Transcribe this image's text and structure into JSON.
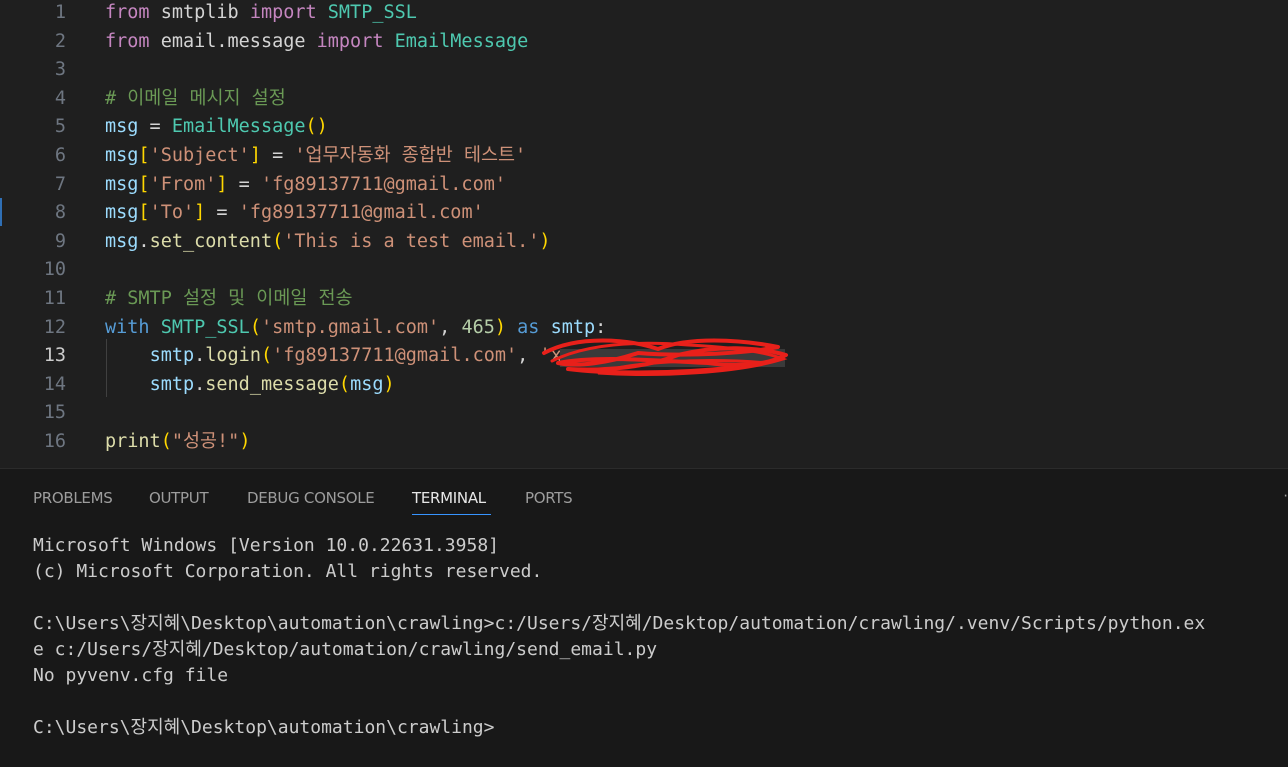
{
  "editor": {
    "active_line": "13",
    "lines": [
      {
        "n": "1",
        "tokens": [
          [
            "kw",
            "from"
          ],
          [
            "pl",
            " "
          ],
          [
            "pl",
            "smtplib"
          ],
          [
            "pl",
            " "
          ],
          [
            "kw",
            "import"
          ],
          [
            "pl",
            " "
          ],
          [
            "cls",
            "SMTP_SSL"
          ]
        ]
      },
      {
        "n": "2",
        "tokens": [
          [
            "kw",
            "from"
          ],
          [
            "pl",
            " "
          ],
          [
            "pl",
            "email.message"
          ],
          [
            "pl",
            " "
          ],
          [
            "kw",
            "import"
          ],
          [
            "pl",
            " "
          ],
          [
            "cls",
            "EmailMessage"
          ]
        ]
      },
      {
        "n": "3",
        "tokens": []
      },
      {
        "n": "4",
        "tokens": [
          [
            "cm",
            "# 이메일 메시지 설정"
          ]
        ]
      },
      {
        "n": "5",
        "tokens": [
          [
            "var",
            "msg"
          ],
          [
            "pl",
            " = "
          ],
          [
            "cls",
            "EmailMessage"
          ],
          [
            "b1",
            "()"
          ]
        ]
      },
      {
        "n": "6",
        "tokens": [
          [
            "var",
            "msg"
          ],
          [
            "b1",
            "["
          ],
          [
            "str",
            "'Subject'"
          ],
          [
            "b1",
            "]"
          ],
          [
            "pl",
            " = "
          ],
          [
            "str",
            "'업무자동화 종합반 테스트'"
          ]
        ]
      },
      {
        "n": "7",
        "tokens": [
          [
            "var",
            "msg"
          ],
          [
            "b1",
            "["
          ],
          [
            "str",
            "'From'"
          ],
          [
            "b1",
            "]"
          ],
          [
            "pl",
            " = "
          ],
          [
            "str",
            "'fg89137711@gmail.com'"
          ]
        ]
      },
      {
        "n": "8",
        "tokens": [
          [
            "var",
            "msg"
          ],
          [
            "b1",
            "["
          ],
          [
            "str",
            "'To'"
          ],
          [
            "b1",
            "]"
          ],
          [
            "pl",
            " = "
          ],
          [
            "str",
            "'fg89137711@gmail.com'"
          ]
        ]
      },
      {
        "n": "9",
        "tokens": [
          [
            "var",
            "msg"
          ],
          [
            "pl",
            "."
          ],
          [
            "fn",
            "set_content"
          ],
          [
            "b1",
            "("
          ],
          [
            "str",
            "'This is a test email.'"
          ],
          [
            "b1",
            ")"
          ]
        ]
      },
      {
        "n": "10",
        "tokens": []
      },
      {
        "n": "11",
        "tokens": [
          [
            "cm",
            "# SMTP 설정 및 이메일 전송"
          ]
        ]
      },
      {
        "n": "12",
        "tokens": [
          [
            "ctrl",
            "with"
          ],
          [
            "pl",
            " "
          ],
          [
            "cls",
            "SMTP_SSL"
          ],
          [
            "b1",
            "("
          ],
          [
            "str",
            "'smtp.gmail.com'"
          ],
          [
            "pl",
            ", "
          ],
          [
            "num",
            "465"
          ],
          [
            "b1",
            ")"
          ],
          [
            "pl",
            " "
          ],
          [
            "ctrl",
            "as"
          ],
          [
            "pl",
            " "
          ],
          [
            "var",
            "smtp"
          ],
          [
            "pl",
            ":"
          ]
        ]
      },
      {
        "n": "13",
        "tokens": [
          [
            "pl",
            "    "
          ],
          [
            "var",
            "smtp"
          ],
          [
            "pl",
            "."
          ],
          [
            "fn",
            "login"
          ],
          [
            "b1",
            "("
          ],
          [
            "str",
            "'fg89137711@gmail.com'"
          ],
          [
            "pl",
            ", "
          ],
          [
            "str",
            "'xxxxxxxxxxxxxxxxxx'"
          ],
          [
            "b1",
            ")"
          ]
        ]
      },
      {
        "n": "14",
        "tokens": [
          [
            "pl",
            "    "
          ],
          [
            "var",
            "smtp"
          ],
          [
            "pl",
            "."
          ],
          [
            "fn",
            "send_message"
          ],
          [
            "b1",
            "("
          ],
          [
            "var",
            "msg"
          ],
          [
            "b1",
            ")"
          ]
        ]
      },
      {
        "n": "15",
        "tokens": []
      },
      {
        "n": "16",
        "tokens": [
          [
            "fn",
            "print"
          ],
          [
            "b1",
            "("
          ],
          [
            "str",
            "\"성공!\""
          ],
          [
            "b1",
            ")"
          ]
        ]
      }
    ]
  },
  "panel": {
    "tabs": [
      "PROBLEMS",
      "OUTPUT",
      "DEBUG CONSOLE",
      "TERMINAL",
      "PORTS"
    ],
    "active_tab": "TERMINAL"
  },
  "terminal": {
    "lines": [
      "Microsoft Windows [Version 10.0.22631.3958]",
      "(c) Microsoft Corporation. All rights reserved.",
      "",
      "C:\\Users\\장지혜\\Desktop\\automation\\crawling>c:/Users/장지혜/Desktop/automation/crawling/.venv/Scripts/python.ex",
      "e c:/Users/장지혜/Desktop/automation/crawling/send_email.py",
      "No pyvenv.cfg file",
      "",
      "C:\\Users\\장지혜\\Desktop\\automation\\crawling>"
    ]
  },
  "colors": {
    "editor_bg": "#1f1f1f",
    "panel_bg": "#181818",
    "keyword": "#c586c0",
    "control": "#569cd6",
    "class": "#4ec9b0",
    "function": "#dcdcaa",
    "variable": "#9cdcfe",
    "string": "#ce9178",
    "number": "#b5cea8",
    "comment": "#6a9955",
    "bracket": "#ffd700",
    "redaction": "#e8201a",
    "tab_active_underline": "#3794ff"
  },
  "icons": {
    "redaction": "red-scribble",
    "panel_more": "ellipsis-icon"
  }
}
